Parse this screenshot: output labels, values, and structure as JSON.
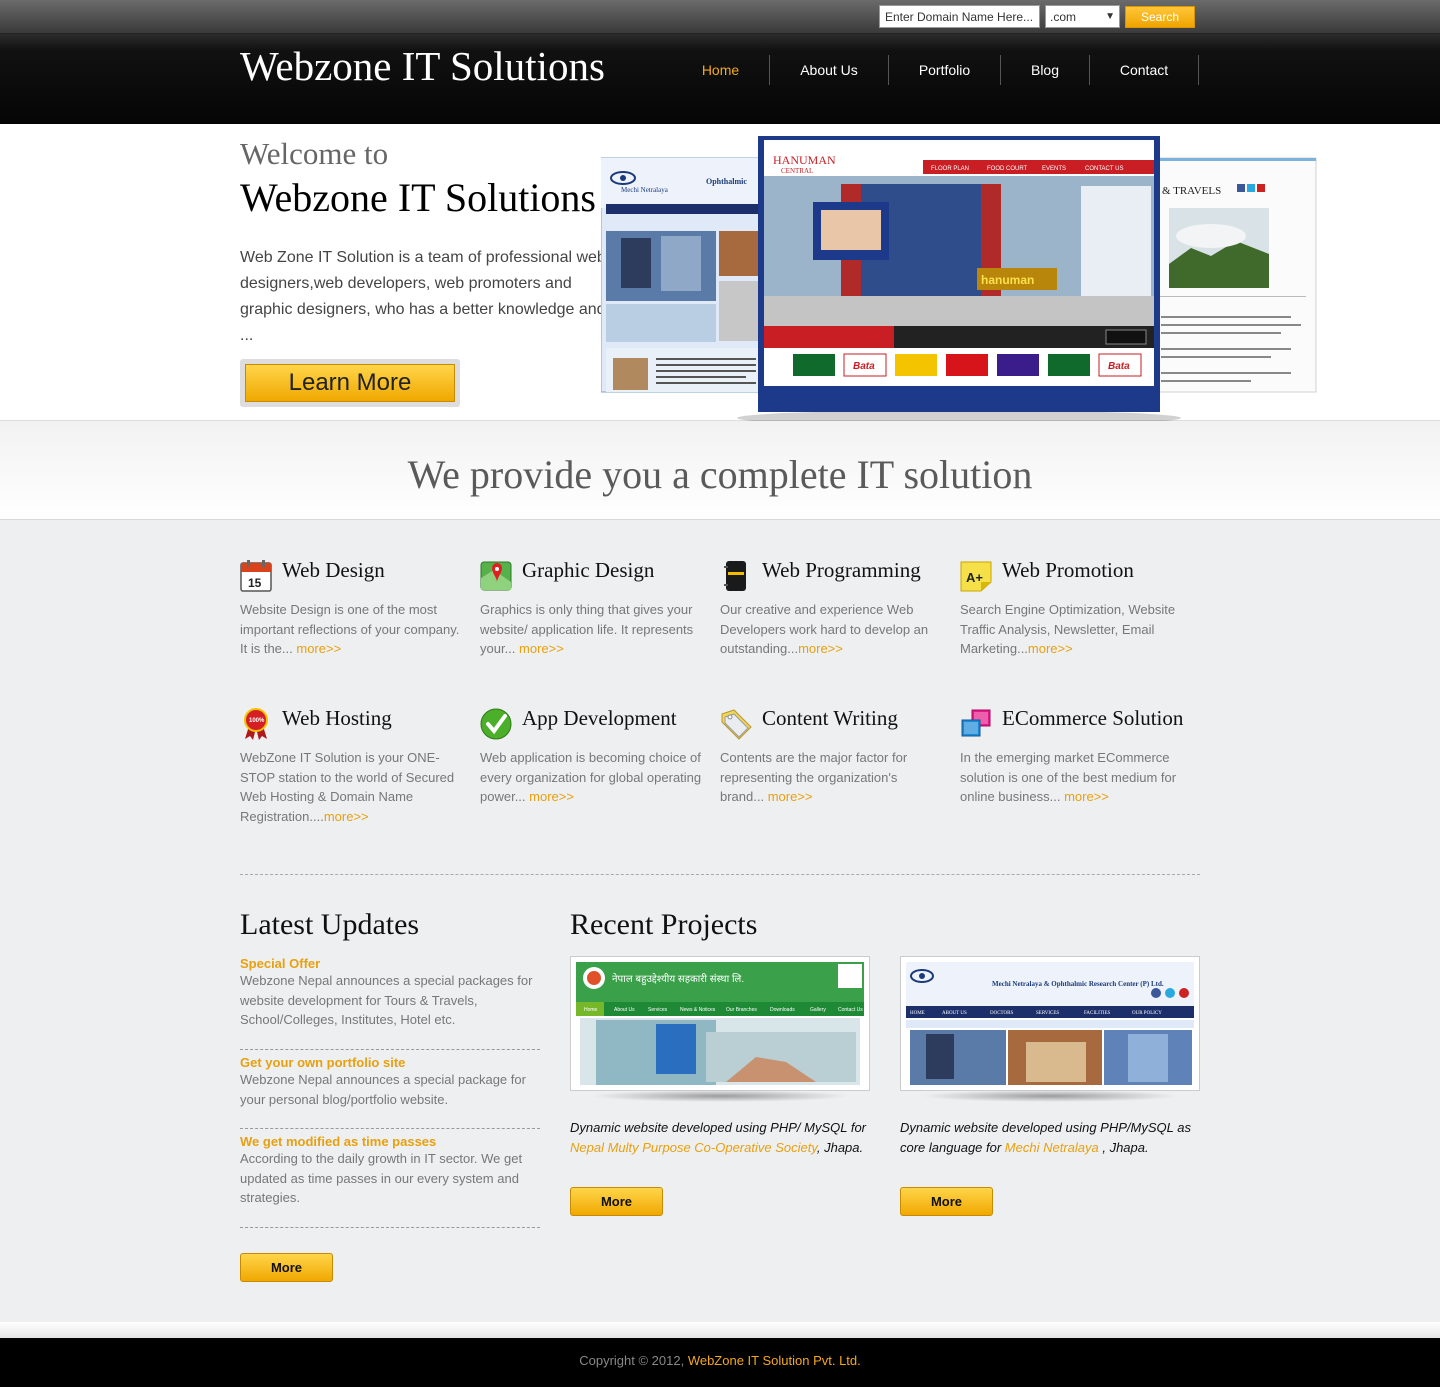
{
  "topbar": {
    "domain_placeholder": "Enter Domain Name Here...",
    "tld_selected": ".com",
    "search_label": "Search"
  },
  "header": {
    "logo": "Webzone IT Solutions",
    "nav": [
      {
        "label": "Home",
        "active": true
      },
      {
        "label": "About Us",
        "active": false
      },
      {
        "label": "Portfolio",
        "active": false
      },
      {
        "label": "Blog",
        "active": false
      },
      {
        "label": "Contact",
        "active": false
      }
    ]
  },
  "hero": {
    "welcome": "Welcome to",
    "title": "Webzone IT Solutions",
    "text": "Web Zone IT Solution is a team of professional web designers,web developers, web promoters and graphic designers, who has a better knowledge and ...",
    "cta": "Learn More",
    "screens": {
      "left_brand": "Mechi Netralaya",
      "left_sub": "Ophthalmic",
      "center_brand": "HANUMAN",
      "center_sub": "CENTRAL",
      "center_menu": [
        "FLOOR PLAN",
        "FOOD COURT",
        "EVENTS",
        "CONTACT US"
      ],
      "right_title": "& TRAVELS"
    }
  },
  "slogan": "We provide you a complete IT solution",
  "services": [
    {
      "icon": "calendar-icon",
      "title": "Web Design",
      "text": "Website Design is one of the most important reflections of your company. It is the... ",
      "more": "more>>"
    },
    {
      "icon": "map-pin-icon",
      "title": "Graphic Design",
      "text": "Graphics is only thing that gives your website/ application life. It represents your... ",
      "more": "more>>"
    },
    {
      "icon": "notebook-icon",
      "title": "Web Programming",
      "text": "Our creative and experience Web Developers work hard to develop an outstanding...",
      "more": "more>>"
    },
    {
      "icon": "grade-note-icon",
      "title": "Web Promotion",
      "text": "Search Engine Optimization, Website Traffic Analysis, Newsletter, Email Marketing...",
      "more": "more>>"
    },
    {
      "icon": "guarantee-badge-icon",
      "title": "Web Hosting",
      "text": "WebZone IT Solution is your ONE-STOP station to the world of Secured Web Hosting & Domain Name Registration....",
      "more": "more>>"
    },
    {
      "icon": "checkmark-icon",
      "title": "App Development",
      "text": "Web application is becoming choice of every organization for global operating power... ",
      "more": "more>>"
    },
    {
      "icon": "price-tag-icon",
      "title": "Content Writing",
      "text": "Contents are the major factor for representing the organization's brand... ",
      "more": "more>>"
    },
    {
      "icon": "windows-icon",
      "title": "ECommerce Solution",
      "text": "In the emerging market ECommerce solution is one of the best medium for online business... ",
      "more": "more>>"
    }
  ],
  "updates": {
    "title": "Latest Updates",
    "items": [
      {
        "title": "Special Offer",
        "text": "Webzone Nepal announces a special packages for website development for Tours & Travels, School/Colleges, Institutes, Hotel etc."
      },
      {
        "title": "Get your own portfolio site",
        "text": "Webzone Nepal announces a special package for your personal blog/portfolio website."
      },
      {
        "title": "We get modified as time passes",
        "text": "According to the daily growth in IT sector. We get updated as time passes in our every system and strategies."
      }
    ],
    "more": "More"
  },
  "projects": {
    "title": "Recent Projects",
    "items": [
      {
        "desc_pre": "Dynamic website developed using PHP/ MySQL for ",
        "client": "Nepal Multy Purpose Co-Operative Society",
        "desc_post": ", Jhapa.",
        "more": "More",
        "thumb_banner": "नेपाल बहुउद्देश्यीय सहकारी संस्था लि.",
        "thumb_menu": [
          "Home",
          "About Us",
          "Services",
          "News & Notices",
          "Our Branches",
          "Downloads",
          "Gallery",
          "Contact Us"
        ]
      },
      {
        "desc_pre": "Dynamic website developed using PHP/MySQL as core language for ",
        "client": "Mechi Netralaya",
        "desc_post": " , Jhapa.",
        "more": "More",
        "thumb_banner": "Mechi Netralaya & Ophthalmic Research Center (P) Ltd.",
        "thumb_menu": [
          "HOME",
          "ABOUT US",
          "DOCTORS",
          "SERVICES",
          "FACILITIES",
          "OUR POLICY"
        ]
      }
    ]
  },
  "footer": {
    "copyright": "Copyright © 2012, ",
    "company": "WebZone IT Solution Pvt. Ltd."
  },
  "colors": {
    "accent": "#f5a81d",
    "header_bg": "#050505",
    "link": "#e8a00f"
  }
}
